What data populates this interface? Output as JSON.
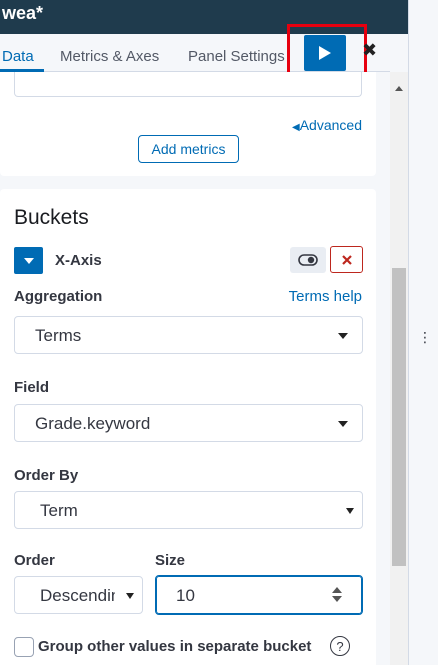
{
  "window": {
    "title": "wea*"
  },
  "tabs": [
    {
      "label": "Data",
      "active": true
    },
    {
      "label": "Metrics & Axes",
      "active": false
    },
    {
      "label": "Panel Settings",
      "active": false
    }
  ],
  "toolbar": {
    "apply_icon": "play-icon",
    "close_icon": "close-icon"
  },
  "metrics_panel": {
    "advanced_link": "Advanced",
    "add_metrics_button": "Add metrics"
  },
  "buckets": {
    "title": "Buckets",
    "agg_title": "X-Axis",
    "aggregation": {
      "label": "Aggregation",
      "help_link": "Terms help",
      "value": "Terms"
    },
    "field": {
      "label": "Field",
      "value": "Grade.keyword"
    },
    "order_by": {
      "label": "Order By",
      "value": "Term"
    },
    "order": {
      "label": "Order",
      "value": "Descending"
    },
    "size": {
      "label": "Size",
      "value": "10"
    },
    "other_bucket": {
      "label": "Group other values in separate bucket",
      "checked": false
    }
  },
  "colors": {
    "accent": "#006bb4",
    "header": "#1f3b4d",
    "danger": "#bd271e",
    "highlight": "#e7000f"
  }
}
